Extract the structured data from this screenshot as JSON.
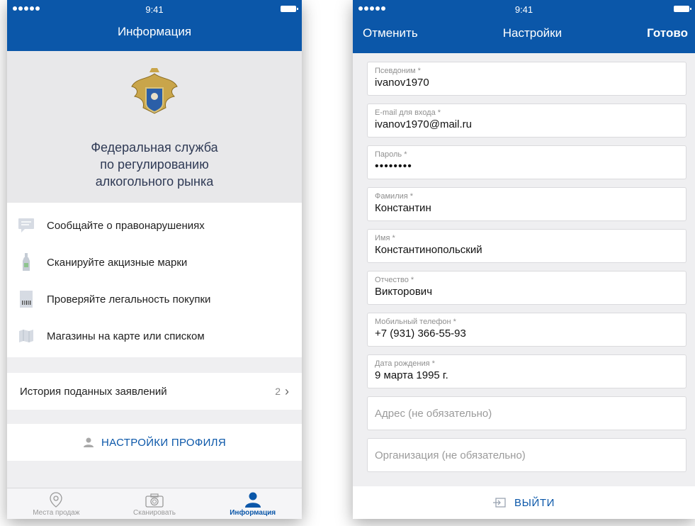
{
  "left": {
    "status": {
      "time": "9:41"
    },
    "title": "Информация",
    "org_name": [
      "Федеральная служба",
      "по регулированию",
      "алкогольного рынка"
    ],
    "features": [
      {
        "icon": "chat-icon",
        "label": "Сообщайте о правонарушениях"
      },
      {
        "icon": "bottle-icon",
        "label": "Сканируйте акцизные марки"
      },
      {
        "icon": "barcode-icon",
        "label": "Проверяйте легальность покупки"
      },
      {
        "icon": "map-icon",
        "label": "Магазины на карте или списком"
      }
    ],
    "history": {
      "label": "История поданных заявлений",
      "count": "2"
    },
    "profile_button": "НАСТРОЙКИ ПРОФИЛЯ",
    "tabs": [
      {
        "icon": "location-pin-icon",
        "label": "Места продаж"
      },
      {
        "icon": "camera-icon",
        "label": "Сканировать"
      },
      {
        "icon": "person-icon",
        "label": "Информация"
      }
    ],
    "active_tab": "Информация"
  },
  "right": {
    "status": {
      "time": "9:41"
    },
    "cancel": "Отменить",
    "title": "Настройки",
    "done": "Готово",
    "fields": [
      {
        "label": "Псевдоним *",
        "value": "ivanov1970"
      },
      {
        "label": "E-mail для входа *",
        "value": "ivanov1970@mail.ru"
      },
      {
        "label": "Пароль *",
        "value": "••••••••"
      },
      {
        "label": "Фамилия *",
        "value": "Константин"
      },
      {
        "label": "Имя *",
        "value": "Константинопольский"
      },
      {
        "label": "Отчество *",
        "value": "Викторович"
      },
      {
        "label": "Мобильный телефон *",
        "value": "+7 (931) 366-55-93"
      },
      {
        "label": "Дата рождения *",
        "value": "9 марта 1995 г."
      },
      {
        "label": "Адрес (не обязательно)",
        "value": ""
      },
      {
        "label": "Организация (не обязательно)",
        "value": ""
      }
    ],
    "logout": "ВЫЙТИ"
  },
  "colors": {
    "brand_blue": "#0b57a9",
    "background": "#efeff1"
  }
}
